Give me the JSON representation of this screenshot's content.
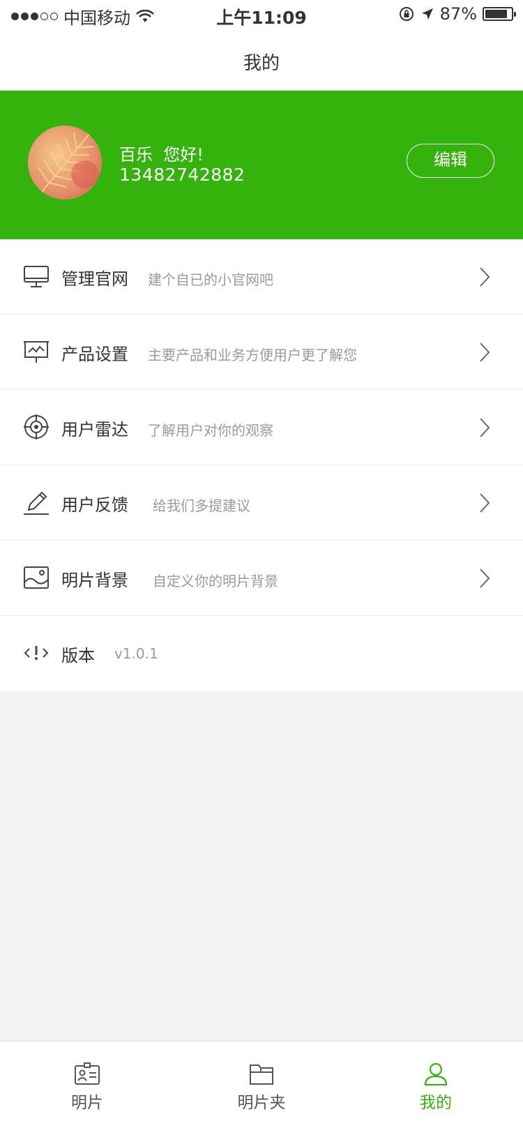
{
  "status_bar": {
    "carrier": "中国移动",
    "time": "上午11:09",
    "battery": "87%",
    "battery_level": 0.87,
    "signal_dots_filled": 3,
    "signal_dots_total": 5
  },
  "nav": {
    "title": "我的"
  },
  "profile": {
    "name": "百乐",
    "greeting": "您好!",
    "phone": "13482742882",
    "edit_label": "编辑"
  },
  "menu": [
    {
      "icon": "monitor-icon",
      "label": "管理官网",
      "desc": "建个自已的小官网吧",
      "chevron": true
    },
    {
      "icon": "presentation-chart-icon",
      "label": "产品设置",
      "desc": "主要产品和业务方便用户更了解您",
      "chevron": true
    },
    {
      "icon": "radar-target-icon",
      "label": "用户雷达",
      "desc": "了解用户对你的观察",
      "chevron": true
    },
    {
      "icon": "pencil-icon",
      "label": "用户反馈",
      "desc": "给我们多提建议",
      "chevron": true
    },
    {
      "icon": "image-icon",
      "label": "明片背景",
      "desc": "自定义你的明片背景",
      "chevron": true
    },
    {
      "icon": "version-code-icon",
      "label": "版本",
      "desc": "v1.0.1",
      "chevron": false
    }
  ],
  "tabs": [
    {
      "icon": "id-card-icon",
      "label": "明片",
      "active": false
    },
    {
      "icon": "folder-icon",
      "label": "明片夹",
      "active": false
    },
    {
      "icon": "user-icon",
      "label": "我的",
      "active": true
    }
  ],
  "colors": {
    "brand_green": "#33b30c",
    "page_bg": "#f4f3f4",
    "desc_gray": "#9b9b9b"
  }
}
